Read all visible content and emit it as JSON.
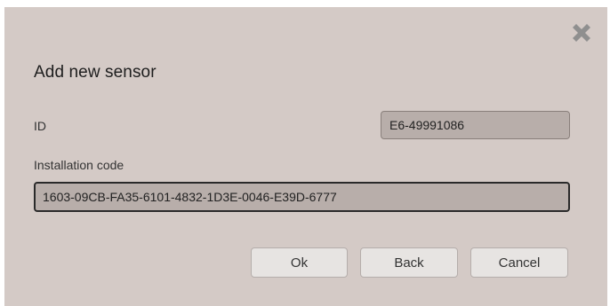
{
  "dialog": {
    "title": "Add new sensor",
    "close_icon": "close-icon"
  },
  "form": {
    "id_label": "ID",
    "id_value": "E6-49991086",
    "installation_code_label": "Installation code",
    "installation_code_value": "1603-09CB-FA35-6101-4832-1D3E-0046-E39D-6777"
  },
  "buttons": {
    "ok_label": "Ok",
    "back_label": "Back",
    "cancel_label": "Cancel"
  },
  "colors": {
    "dialog_background": "#d4cac6",
    "input_background": "#b8aeaa",
    "button_background": "#e7e4e2"
  }
}
